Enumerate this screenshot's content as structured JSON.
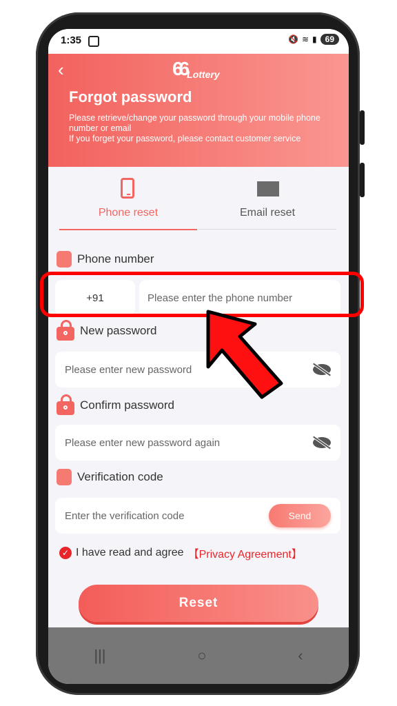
{
  "status_bar": {
    "time": "1:35",
    "battery": "69"
  },
  "header": {
    "logo_number": "66",
    "logo_text": "Lottery",
    "title": "Forgot password",
    "description_line1": "Please retrieve/change your password through your mobile phone number or email",
    "description_line2": "If you forget your password, please contact customer service"
  },
  "tabs": [
    {
      "label": "Phone reset",
      "active": true
    },
    {
      "label": "Email reset",
      "active": false
    }
  ],
  "form": {
    "phone_label": "Phone number",
    "country_code": "+91",
    "phone_placeholder": "Please enter the phone number",
    "new_password_label": "New password",
    "new_password_placeholder": "Please enter new password",
    "confirm_password_label": "Confirm password",
    "confirm_password_placeholder": "Please enter new password again",
    "verification_label": "Verification code",
    "verification_placeholder": "Enter the verification code",
    "send_label": "Send"
  },
  "agreement": {
    "text": "I have read and agree",
    "link": "【Privacy Agreement】"
  },
  "reset_label": "Reset",
  "colors": {
    "accent": "#f26560",
    "highlight": "#ff0000"
  }
}
